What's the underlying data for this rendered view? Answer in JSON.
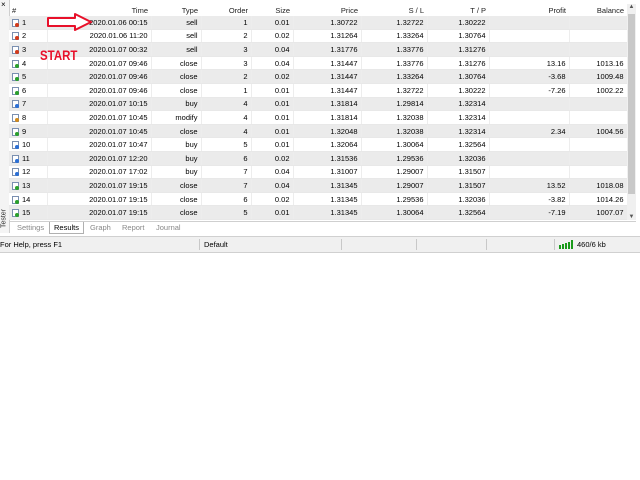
{
  "window": {
    "close_glyph": "×",
    "vertical_tab_label": "Tester"
  },
  "table": {
    "columns": [
      "#",
      "Time",
      "Type",
      "Order",
      "Size",
      "Price",
      "S / L",
      "T / P",
      "Profit",
      "Balance"
    ],
    "rows": [
      {
        "n": "1",
        "icon": "sell-icon",
        "time": "2020.01.06 00:15",
        "type": "sell",
        "order": "1",
        "size": "0.01",
        "price": "1.30722",
        "sl": "1.32722",
        "tp": "1.30222",
        "profit": "",
        "balance": ""
      },
      {
        "n": "2",
        "icon": "sell-icon",
        "time": "2020.01.06 11:20",
        "type": "sell",
        "order": "2",
        "size": "0.02",
        "price": "1.31264",
        "sl": "1.33264",
        "tp": "1.30764",
        "profit": "",
        "balance": ""
      },
      {
        "n": "3",
        "icon": "sell-icon",
        "time": "2020.01.07 00:32",
        "type": "sell",
        "order": "3",
        "size": "0.04",
        "price": "1.31776",
        "sl": "1.33776",
        "tp": "1.31276",
        "profit": "",
        "balance": ""
      },
      {
        "n": "4",
        "icon": "close-icon",
        "time": "2020.01.07 09:46",
        "type": "close",
        "order": "3",
        "size": "0.04",
        "price": "1.31447",
        "sl": "1.33776",
        "tp": "1.31276",
        "profit": "13.16",
        "balance": "1013.16"
      },
      {
        "n": "5",
        "icon": "close-icon",
        "time": "2020.01.07 09:46",
        "type": "close",
        "order": "2",
        "size": "0.02",
        "price": "1.31447",
        "sl": "1.33264",
        "tp": "1.30764",
        "profit": "-3.68",
        "balance": "1009.48"
      },
      {
        "n": "6",
        "icon": "close-icon",
        "time": "2020.01.07 09:46",
        "type": "close",
        "order": "1",
        "size": "0.01",
        "price": "1.31447",
        "sl": "1.32722",
        "tp": "1.30222",
        "profit": "-7.26",
        "balance": "1002.22"
      },
      {
        "n": "7",
        "icon": "buy-icon",
        "time": "2020.01.07 10:15",
        "type": "buy",
        "order": "4",
        "size": "0.01",
        "price": "1.31814",
        "sl": "1.29814",
        "tp": "1.32314",
        "profit": "",
        "balance": ""
      },
      {
        "n": "8",
        "icon": "modify-icon",
        "time": "2020.01.07 10:45",
        "type": "modify",
        "order": "4",
        "size": "0.01",
        "price": "1.31814",
        "sl": "1.32038",
        "tp": "1.32314",
        "profit": "",
        "balance": ""
      },
      {
        "n": "9",
        "icon": "close-icon",
        "time": "2020.01.07 10:45",
        "type": "close",
        "order": "4",
        "size": "0.01",
        "price": "1.32048",
        "sl": "1.32038",
        "tp": "1.32314",
        "profit": "2.34",
        "balance": "1004.56"
      },
      {
        "n": "10",
        "icon": "buy-icon",
        "time": "2020.01.07 10:47",
        "type": "buy",
        "order": "5",
        "size": "0.01",
        "price": "1.32064",
        "sl": "1.30064",
        "tp": "1.32564",
        "profit": "",
        "balance": ""
      },
      {
        "n": "11",
        "icon": "buy-icon",
        "time": "2020.01.07 12:20",
        "type": "buy",
        "order": "6",
        "size": "0.02",
        "price": "1.31536",
        "sl": "1.29536",
        "tp": "1.32036",
        "profit": "",
        "balance": ""
      },
      {
        "n": "12",
        "icon": "buy-icon",
        "time": "2020.01.07 17:02",
        "type": "buy",
        "order": "7",
        "size": "0.04",
        "price": "1.31007",
        "sl": "1.29007",
        "tp": "1.31507",
        "profit": "",
        "balance": ""
      },
      {
        "n": "13",
        "icon": "close-icon",
        "time": "2020.01.07 19:15",
        "type": "close",
        "order": "7",
        "size": "0.04",
        "price": "1.31345",
        "sl": "1.29007",
        "tp": "1.31507",
        "profit": "13.52",
        "balance": "1018.08"
      },
      {
        "n": "14",
        "icon": "close-icon",
        "time": "2020.01.07 19:15",
        "type": "close",
        "order": "6",
        "size": "0.02",
        "price": "1.31345",
        "sl": "1.29536",
        "tp": "1.32036",
        "profit": "-3.82",
        "balance": "1014.26"
      },
      {
        "n": "15",
        "icon": "close-icon",
        "time": "2020.01.07 19:15",
        "type": "close",
        "order": "5",
        "size": "0.01",
        "price": "1.31345",
        "sl": "1.30064",
        "tp": "1.32564",
        "profit": "-7.19",
        "balance": "1007.07"
      },
      {
        "n": "16",
        "icon": "sell-icon",
        "time": "2020.01.07 19:17",
        "type": "sell",
        "order": "8",
        "size": "0.01",
        "price": "1.31330",
        "sl": "1.33330",
        "tp": "1.30830",
        "profit": "",
        "balance": ""
      }
    ]
  },
  "tabs": [
    {
      "label": "Settings",
      "active": false
    },
    {
      "label": "Results",
      "active": true
    },
    {
      "label": "Graph",
      "active": false
    },
    {
      "label": "Report",
      "active": false
    },
    {
      "label": "Journal",
      "active": false
    }
  ],
  "statusbar": {
    "help_text": "For Help, press F1",
    "profile": "Default",
    "traffic": "460/6 kb"
  },
  "annotation": {
    "label": "START",
    "color": "#e8102a"
  }
}
